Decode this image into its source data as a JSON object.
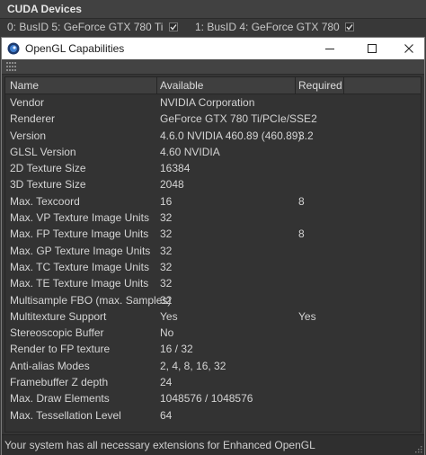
{
  "background_panel": {
    "title": "CUDA Devices",
    "devices": [
      {
        "label": "0: BusID 5: GeForce GTX 780 Ti"
      },
      {
        "label": "1: BusID 4: GeForce GTX 780"
      }
    ]
  },
  "dialog": {
    "title": "OpenGL Capabilities",
    "icon": "app-icon"
  },
  "table": {
    "columns": [
      "Name",
      "Available",
      "Required"
    ],
    "rows": [
      [
        "Vendor",
        "NVIDIA Corporation",
        ""
      ],
      [
        "Renderer",
        "GeForce GTX 780 Ti/PCIe/SSE2",
        ""
      ],
      [
        "Version",
        "4.6.0 NVIDIA 460.89 (460.89)",
        "3.2"
      ],
      [
        "GLSL Version",
        "4.60 NVIDIA",
        ""
      ],
      [
        "2D Texture Size",
        "16384",
        ""
      ],
      [
        "3D Texture Size",
        "2048",
        ""
      ],
      [
        "Max. Texcoord",
        "16",
        "8"
      ],
      [
        "Max. VP Texture Image Units",
        "32",
        ""
      ],
      [
        "Max. FP Texture Image Units",
        "32",
        "8"
      ],
      [
        "Max. GP Texture Image Units",
        "32",
        ""
      ],
      [
        "Max. TC Texture Image Units",
        "32",
        ""
      ],
      [
        "Max. TE Texture Image Units",
        "32",
        ""
      ],
      [
        "Multisample FBO (max. Samples)",
        "32",
        ""
      ],
      [
        "Multitexture Support",
        "Yes",
        "Yes"
      ],
      [
        "Stereoscopic Buffer",
        "No",
        ""
      ],
      [
        "Render to FP texture",
        "16 / 32",
        ""
      ],
      [
        "Anti-alias Modes",
        "2, 4, 8, 16, 32",
        ""
      ],
      [
        "Framebuffer Z depth",
        "24",
        ""
      ],
      [
        "Max. Draw Elements",
        "1048576 / 1048576",
        ""
      ],
      [
        "Max. Tessellation Level",
        "64",
        ""
      ]
    ]
  },
  "status": {
    "message": "Your system has all necessary extensions for Enhanced OpenGL"
  }
}
